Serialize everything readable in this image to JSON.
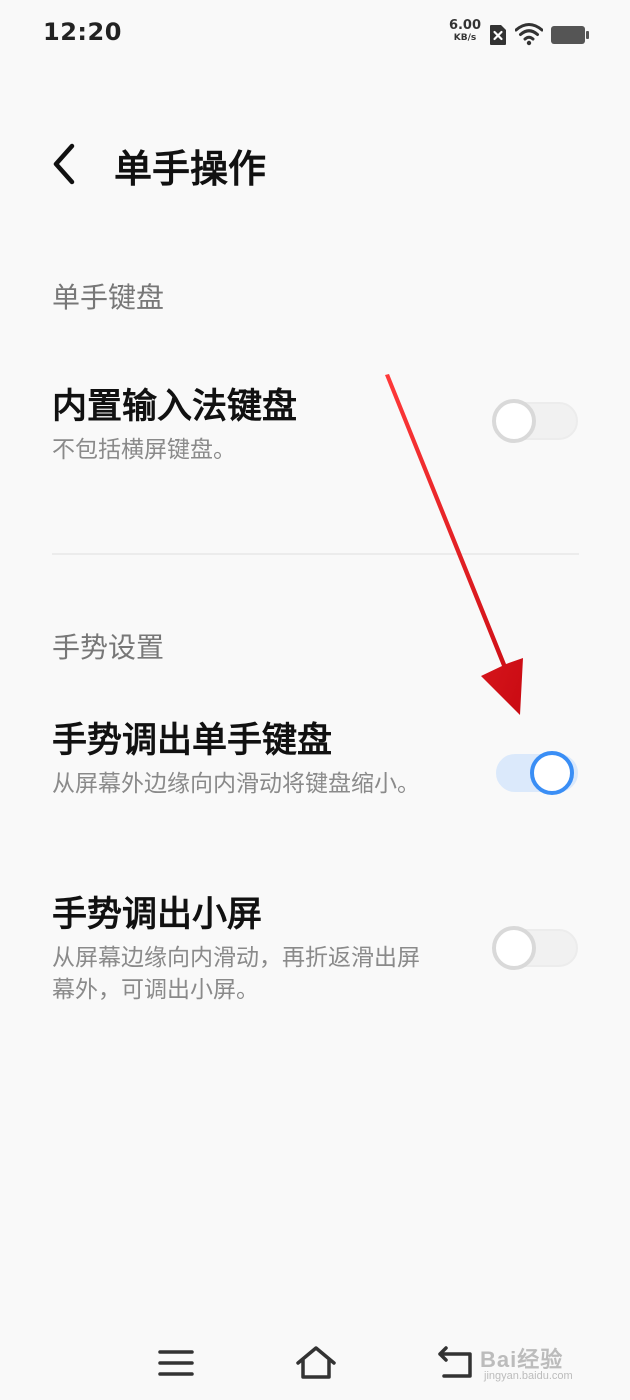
{
  "status_bar": {
    "time": "12:20",
    "net_speed_value": "6.00",
    "net_speed_unit": "KB/s",
    "icons": [
      "sim-x-icon",
      "wifi-icon",
      "battery-icon"
    ]
  },
  "header": {
    "back_icon": "chevron-left-icon",
    "title": "单手操作"
  },
  "sections": [
    {
      "header": "单手键盘",
      "items": [
        {
          "title": "内置输入法键盘",
          "description": "不包括横屏键盘。",
          "enabled": false
        }
      ]
    },
    {
      "header": "手势设置",
      "items": [
        {
          "title": "手势调出单手键盘",
          "description": "从屏幕外边缘向内滑动将键盘缩小。",
          "enabled": true
        },
        {
          "title": "手势调出小屏",
          "description": "从屏幕边缘向内滑动，再折返滑出屏幕外，可调出小屏。",
          "enabled": false
        }
      ]
    }
  ],
  "colors": {
    "accent": "#3a8ef5",
    "annotation_arrow": "#e8141c"
  },
  "nav_bar": {
    "icons": [
      "menu-icon",
      "home-icon",
      "back-icon"
    ]
  },
  "watermark": {
    "main": "Bai经验",
    "sub": "jingyan.baidu.com"
  }
}
